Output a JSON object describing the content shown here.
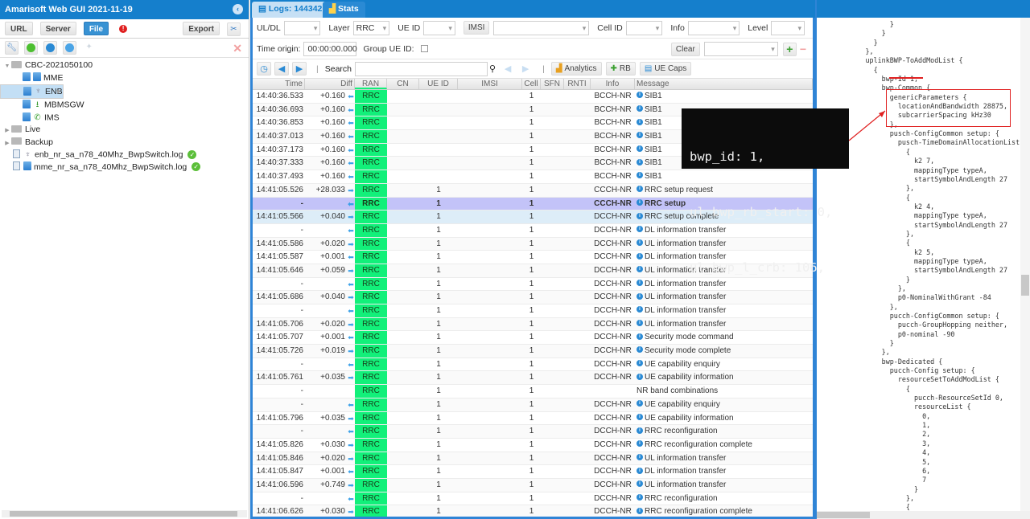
{
  "app": {
    "title": "Amarisoft Web GUI 2021-11-19"
  },
  "left_panel": {
    "buttons": {
      "url": "URL",
      "server": "Server",
      "file": "File",
      "export": "Export"
    },
    "tree": [
      {
        "label": "CBC-2021050100",
        "type": "folder",
        "expanded": true,
        "level": 0
      },
      {
        "label": "MME",
        "type": "server",
        "icon": "database-icon",
        "level": 1
      },
      {
        "label": "ENB",
        "type": "server",
        "icon": "antenna-icon",
        "level": 1,
        "selected": true
      },
      {
        "label": "MBMSGW",
        "type": "server",
        "icon": "download-icon",
        "level": 1
      },
      {
        "label": "IMS",
        "type": "server",
        "icon": "phone-icon",
        "level": 1
      },
      {
        "label": "Live",
        "type": "folder",
        "expanded": false,
        "level": 0
      },
      {
        "label": "Backup",
        "type": "folder",
        "expanded": false,
        "level": 0
      },
      {
        "label": "enb_nr_sa_n78_40Mhz_BwpSwitch.log",
        "type": "file",
        "status": "ok",
        "level": 0
      },
      {
        "label": "mme_nr_sa_n78_40Mhz_BwpSwitch.log",
        "type": "file",
        "status": "ok",
        "level": 0
      }
    ]
  },
  "tabs": [
    {
      "label": "Logs: 144342",
      "active": true
    },
    {
      "label": "Stats",
      "active": false
    }
  ],
  "filters": {
    "uldl_label": "UL/DL",
    "uldl_value": "",
    "layer_label": "Layer",
    "layer_value": "RRC",
    "ueid_label": "UE ID",
    "ueid_value": "",
    "imsi_button": "IMSI",
    "imsi_value": "",
    "cellid_label": "Cell ID",
    "cellid_value": "",
    "info_label": "Info",
    "info_value": "",
    "level_label": "Level",
    "level_value": "",
    "time_origin_label": "Time origin:",
    "time_origin_value": "00:00:00.000",
    "group_ueid_label": "Group UE ID:",
    "clear_button": "Clear"
  },
  "toolbar": {
    "search_label": "Search",
    "search_value": "",
    "analytics": "Analytics",
    "rb": "RB",
    "ue_caps": "UE Caps"
  },
  "grid": {
    "columns": [
      "Time",
      "Diff",
      "RAN",
      "CN",
      "UE ID",
      "IMSI",
      "Cell",
      "SFN",
      "RNTI",
      "Info",
      "Message"
    ],
    "rows": [
      {
        "time": "14:40:36.533",
        "diff": "+0.160",
        "dir": "dl",
        "ran": "RRC",
        "ue": "",
        "cell": "1",
        "info": "BCCH-NR",
        "msg": "SIB1",
        "icon": true
      },
      {
        "time": "14:40:36.693",
        "diff": "+0.160",
        "dir": "dl",
        "ran": "RRC",
        "ue": "",
        "cell": "1",
        "info": "BCCH-NR",
        "msg": "SIB1",
        "icon": true
      },
      {
        "time": "14:40:36.853",
        "diff": "+0.160",
        "dir": "dl",
        "ran": "RRC",
        "ue": "",
        "cell": "1",
        "info": "BCCH-NR",
        "msg": "SIB1",
        "icon": true
      },
      {
        "time": "14:40:37.013",
        "diff": "+0.160",
        "dir": "dl",
        "ran": "RRC",
        "ue": "",
        "cell": "1",
        "info": "BCCH-NR",
        "msg": "SIB1",
        "icon": true
      },
      {
        "time": "14:40:37.173",
        "diff": "+0.160",
        "dir": "dl",
        "ran": "RRC",
        "ue": "",
        "cell": "1",
        "info": "BCCH-NR",
        "msg": "SIB1",
        "icon": true
      },
      {
        "time": "14:40:37.333",
        "diff": "+0.160",
        "dir": "dl",
        "ran": "RRC",
        "ue": "",
        "cell": "1",
        "info": "BCCH-NR",
        "msg": "SIB1",
        "icon": true
      },
      {
        "time": "14:40:37.493",
        "diff": "+0.160",
        "dir": "dl",
        "ran": "RRC",
        "ue": "",
        "cell": "1",
        "info": "BCCH-NR",
        "msg": "SIB1",
        "icon": true
      },
      {
        "time": "14:41:05.526",
        "diff": "+28.033",
        "dir": "ul",
        "ran": "RRC",
        "ue": "1",
        "cell": "1",
        "info": "CCCH-NR",
        "msg": "RRC setup request",
        "icon": true
      },
      {
        "time": "-",
        "diff": "",
        "dir": "dl",
        "ran": "RRC",
        "ue": "1",
        "cell": "1",
        "info": "CCCH-NR",
        "msg": "RRC setup",
        "icon": true,
        "selected": true
      },
      {
        "time": "14:41:05.566",
        "diff": "+0.040",
        "dir": "ul",
        "ran": "RRC",
        "ue": "1",
        "cell": "1",
        "info": "DCCH-NR",
        "msg": "RRC setup complete",
        "icon": true,
        "hover": true
      },
      {
        "time": "-",
        "diff": "",
        "dir": "dl",
        "ran": "RRC",
        "ue": "1",
        "cell": "1",
        "info": "DCCH-NR",
        "msg": "DL information transfer",
        "icon": true
      },
      {
        "time": "14:41:05.586",
        "diff": "+0.020",
        "dir": "ul",
        "ran": "RRC",
        "ue": "1",
        "cell": "1",
        "info": "DCCH-NR",
        "msg": "UL information transfer",
        "icon": true
      },
      {
        "time": "14:41:05.587",
        "diff": "+0.001",
        "dir": "dl",
        "ran": "RRC",
        "ue": "1",
        "cell": "1",
        "info": "DCCH-NR",
        "msg": "DL information transfer",
        "icon": true
      },
      {
        "time": "14:41:05.646",
        "diff": "+0.059",
        "dir": "ul",
        "ran": "RRC",
        "ue": "1",
        "cell": "1",
        "info": "DCCH-NR",
        "msg": "UL information transfer",
        "icon": true
      },
      {
        "time": "-",
        "diff": "",
        "dir": "dl",
        "ran": "RRC",
        "ue": "1",
        "cell": "1",
        "info": "DCCH-NR",
        "msg": "DL information transfer",
        "icon": true
      },
      {
        "time": "14:41:05.686",
        "diff": "+0.040",
        "dir": "ul",
        "ran": "RRC",
        "ue": "1",
        "cell": "1",
        "info": "DCCH-NR",
        "msg": "UL information transfer",
        "icon": true
      },
      {
        "time": "-",
        "diff": "",
        "dir": "dl",
        "ran": "RRC",
        "ue": "1",
        "cell": "1",
        "info": "DCCH-NR",
        "msg": "DL information transfer",
        "icon": true
      },
      {
        "time": "14:41:05.706",
        "diff": "+0.020",
        "dir": "ul",
        "ran": "RRC",
        "ue": "1",
        "cell": "1",
        "info": "DCCH-NR",
        "msg": "UL information transfer",
        "icon": true
      },
      {
        "time": "14:41:05.707",
        "diff": "+0.001",
        "dir": "dl",
        "ran": "RRC",
        "ue": "1",
        "cell": "1",
        "info": "DCCH-NR",
        "msg": "Security mode command",
        "icon": true
      },
      {
        "time": "14:41:05.726",
        "diff": "+0.019",
        "dir": "ul",
        "ran": "RRC",
        "ue": "1",
        "cell": "1",
        "info": "DCCH-NR",
        "msg": "Security mode complete",
        "icon": true
      },
      {
        "time": "-",
        "diff": "",
        "dir": "dl",
        "ran": "RRC",
        "ue": "1",
        "cell": "1",
        "info": "DCCH-NR",
        "msg": "UE capability enquiry",
        "icon": true
      },
      {
        "time": "14:41:05.761",
        "diff": "+0.035",
        "dir": "ul",
        "ran": "RRC",
        "ue": "1",
        "cell": "1",
        "info": "DCCH-NR",
        "msg": "UE capability information",
        "icon": true
      },
      {
        "time": "-",
        "diff": "",
        "dir": "",
        "ran": "RRC",
        "ue": "1",
        "cell": "1",
        "info": "",
        "msg": "NR band combinations",
        "icon": false
      },
      {
        "time": "-",
        "diff": "",
        "dir": "dl",
        "ran": "RRC",
        "ue": "1",
        "cell": "1",
        "info": "DCCH-NR",
        "msg": "UE capability enquiry",
        "icon": true
      },
      {
        "time": "14:41:05.796",
        "diff": "+0.035",
        "dir": "ul",
        "ran": "RRC",
        "ue": "1",
        "cell": "1",
        "info": "DCCH-NR",
        "msg": "UE capability information",
        "icon": true
      },
      {
        "time": "-",
        "diff": "",
        "dir": "dl",
        "ran": "RRC",
        "ue": "1",
        "cell": "1",
        "info": "DCCH-NR",
        "msg": "RRC reconfiguration",
        "icon": true
      },
      {
        "time": "14:41:05.826",
        "diff": "+0.030",
        "dir": "ul",
        "ran": "RRC",
        "ue": "1",
        "cell": "1",
        "info": "DCCH-NR",
        "msg": "RRC reconfiguration complete",
        "icon": true
      },
      {
        "time": "14:41:05.846",
        "diff": "+0.020",
        "dir": "ul",
        "ran": "RRC",
        "ue": "1",
        "cell": "1",
        "info": "DCCH-NR",
        "msg": "UL information transfer",
        "icon": true
      },
      {
        "time": "14:41:05.847",
        "diff": "+0.001",
        "dir": "dl",
        "ran": "RRC",
        "ue": "1",
        "cell": "1",
        "info": "DCCH-NR",
        "msg": "DL information transfer",
        "icon": true
      },
      {
        "time": "14:41:06.596",
        "diff": "+0.749",
        "dir": "ul",
        "ran": "RRC",
        "ue": "1",
        "cell": "1",
        "info": "DCCH-NR",
        "msg": "UL information transfer",
        "icon": true
      },
      {
        "time": "-",
        "diff": "",
        "dir": "dl",
        "ran": "RRC",
        "ue": "1",
        "cell": "1",
        "info": "DCCH-NR",
        "msg": "RRC reconfiguration",
        "icon": true
      },
      {
        "time": "14:41:06.626",
        "diff": "+0.030",
        "dir": "ul",
        "ran": "RRC",
        "ue": "1",
        "cell": "1",
        "info": "DCCH-NR",
        "msg": "RRC reconfiguration complete",
        "icon": true
      }
    ]
  },
  "overlay": {
    "lines": [
      "bwp_id: 1,",
      "ul_bwp_rb_start: 0,",
      "ul_bwp_l_crb: 106,"
    ]
  },
  "detail": {
    "lines": [
      "                  }",
      "                }",
      "              }",
      "            },",
      "            uplinkBWP-ToAddModList {",
      "              {",
      "                bwp-Id 1,",
      "                bwp-Common {",
      "                  genericParameters {",
      "                    locationAndBandwidth 28875,",
      "                    subcarrierSpacing kHz30",
      "                  },",
      "                  pusch-ConfigCommon setup: {",
      "                    pusch-TimeDomainAllocationList {",
      "                      {",
      "                        k2 7,",
      "                        mappingType typeA,",
      "                        startSymbolAndLength 27",
      "                      },",
      "                      {",
      "                        k2 4,",
      "                        mappingType typeA,",
      "                        startSymbolAndLength 27",
      "                      },",
      "                      {",
      "                        k2 5,",
      "                        mappingType typeA,",
      "                        startSymbolAndLength 27",
      "                      }",
      "                    },",
      "                    p0-NominalWithGrant -84",
      "                  },",
      "                  pucch-ConfigCommon setup: {",
      "                    pucch-GroupHopping neither,",
      "                    p0-nominal -90",
      "                  }",
      "                },",
      "                bwp-Dedicated {",
      "                  pucch-Config setup: {",
      "                    resourceSetToAddModList {",
      "                      {",
      "                        pucch-ResourceSetId 0,",
      "                        resourceList {",
      "                          0,",
      "                          1,",
      "                          2,",
      "                          3,",
      "                          4,",
      "                          5,",
      "                          6,",
      "                          7",
      "                        }",
      "                      },",
      "                      {"
    ]
  },
  "colors": {
    "brand_blue": "#157fcc",
    "ran_green": "#12f07a",
    "selected_row": "#c3c3f8",
    "annotation_red": "#e02020"
  }
}
